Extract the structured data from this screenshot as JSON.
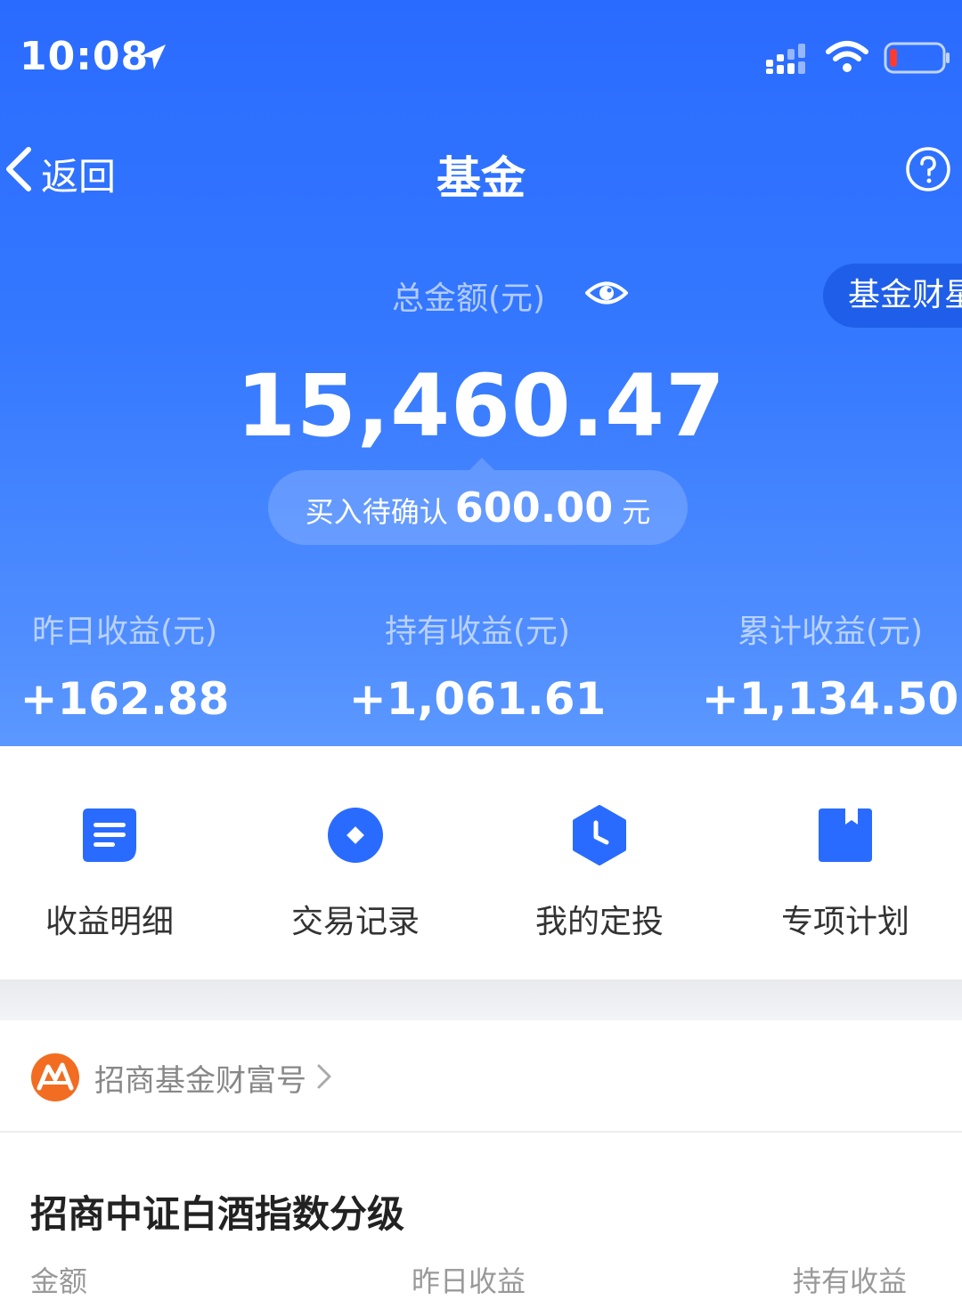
{
  "status_bar": {
    "time": "10:08"
  },
  "nav": {
    "back_label": "返回",
    "title": "基金"
  },
  "summary": {
    "total_label": "总金额(元)",
    "total_amount": "15,460.47",
    "wealth_pill_label": "基金财星",
    "pending": {
      "label": "买入待确认",
      "amount": "600.00",
      "unit": "元"
    }
  },
  "stats": [
    {
      "label": "昨日收益(元)",
      "value": "+162.88"
    },
    {
      "label": "持有收益(元)",
      "value": "+1,061.61"
    },
    {
      "label": "累计收益(元)",
      "value": "+1,134.50"
    }
  ],
  "actions": [
    {
      "label": "收益明细",
      "icon": "document-icon"
    },
    {
      "label": "交易记录",
      "icon": "record-icon"
    },
    {
      "label": "我的定投",
      "icon": "clock-icon"
    },
    {
      "label": "专项计划",
      "icon": "bookmark-icon"
    }
  ],
  "fund_card": {
    "brand_label": "招商基金财富号",
    "fund_name": "招商中证白酒指数分级",
    "columns": [
      "金额",
      "昨日收益",
      "持有收益"
    ]
  },
  "colors": {
    "primary": "#2a6bff",
    "brand_orange": "#f26d21",
    "battery_low": "#ff3b30"
  }
}
